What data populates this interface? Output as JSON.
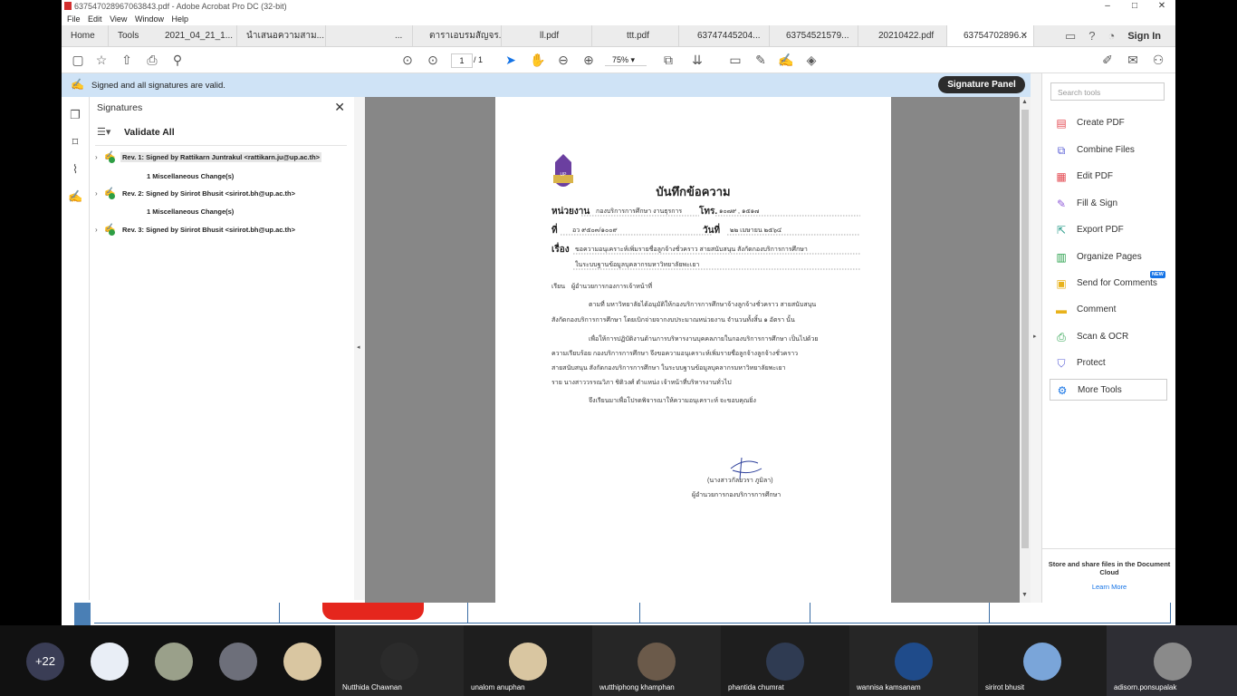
{
  "window": {
    "title": "637547028967063843.pdf - Adobe Acrobat Pro DC (32-bit)",
    "controls": [
      "–",
      "□",
      "✕"
    ]
  },
  "menu": [
    "File",
    "Edit",
    "View",
    "Window",
    "Help"
  ],
  "tabs": [
    {
      "label": "Home"
    },
    {
      "label": "Tools"
    },
    {
      "label": "2021_04_21_1..."
    },
    {
      "label": "นำเสนอความสาม..."
    },
    {
      "label": "..."
    },
    {
      "label": "ตาราเอบรมสัญจร..."
    },
    {
      "label": "ll.pdf"
    },
    {
      "label": "ttt.pdf"
    },
    {
      "label": "63747445204..."
    },
    {
      "label": "63754521579..."
    },
    {
      "label": "20210422.pdf"
    },
    {
      "label": "63754702896...",
      "active": true
    }
  ],
  "header_right": {
    "sign_in": "Sign In"
  },
  "toolbar": {
    "page_current": "1",
    "page_total": "/ 1",
    "zoom": "75%"
  },
  "signature_bar": {
    "message": "Signed and all signatures are valid.",
    "panel_button": "Signature Panel"
  },
  "signatures_panel": {
    "title": "Signatures",
    "validate_all": "Validate All",
    "revisions": [
      {
        "label": "Rev. 1: Signed by Rattikarn Juntrakul <rattikarn.ju@up.ac.th>",
        "sub": "1 Miscellaneous Change(s)"
      },
      {
        "label": "Rev. 2: Signed by Sirirot Bhusit <sirirot.bh@up.ac.th>",
        "sub": "1 Miscellaneous Change(s)"
      },
      {
        "label": "Rev. 3: Signed by Sirirot Bhusit <sirirot.bh@up.ac.th>",
        "sub": ""
      }
    ]
  },
  "document": {
    "logo_text": "UP",
    "title": "บันทึกข้อความ",
    "agency_label": "หน่วยงาน",
    "agency_value": "กองบริการการศึกษา  งานธุรการ",
    "phone_label": "โทร.",
    "phone_value": "๑๐๗๙ , ๑๕๑๗",
    "ref_label": "ที่",
    "ref_value": "อว ๙๕๐๓/๑๐๐๙",
    "date_label": "วันที่",
    "date_value": "๒๒ เมษายน ๒๕๖๔",
    "subject_label": "เรื่อง",
    "subject_line1": "ขอความอนุเคราะห์เพิ่มรายชื่อลูกจ้างชั่วคราว สายสนับสนุน สังกัดกองบริการการศึกษา",
    "subject_line2": "ในระบบฐานข้อมูลบุคลากรมหาวิทยาลัยพะเยา",
    "to_label": "เรียน",
    "to_value": "ผู้อำนวยการกองการเจ้าหน้าที่",
    "para1_l1": "ตามที่ มหาวิทยาลัยได้อนุมัติให้กองบริการการศึกษาจ้างลูกจ้างชั่วคราว สายสนับสนุน",
    "para1_l2": "สังกัดกองบริการการศึกษา โดยเบิกจ่ายจากงบประมาณหน่วยงาน จำนวนทั้งสิ้น ๑ อัตรา นั้น",
    "para2_l1": "เพื่อให้การปฏิบัติงานด้านการบริหารงานบุคคลภายในกองบริการการศึกษา เป็นไปด้วย",
    "para2_l2": "ความเรียบร้อย กองบริการการศึกษา จึงขอความอนุเคราะห์เพิ่มรายชื่อลูกจ้างลูกจ้างชั่วคราว",
    "para2_l3": "สายสนับสนุน สังกัดกองบริการการศึกษา ในระบบฐานข้อมูลบุคลากรมหาวิทยาลัยพะเยา",
    "para2_l4": "ราย นางสาววรรณวิภา  ชิติวงศ์ ตำแหน่ง เจ้าหน้าที่บริหารงานทั่วไป",
    "closing": "จึงเรียนมาเพื่อโปรดพิจารณาให้ความอนุเคราะห์ จะขอบคุณยิ่ง",
    "signer_name": "(นางสาวกัลยวรา  ภูมิลา)",
    "signer_position": "ผู้อำนวยการกองบริการการศึกษา"
  },
  "tools": {
    "search_placeholder": "Search tools",
    "items": [
      {
        "label": "Create PDF",
        "icon": "create-pdf-icon",
        "color": "#e34850"
      },
      {
        "label": "Combine Files",
        "icon": "combine-files-icon",
        "color": "#5a5fd6"
      },
      {
        "label": "Edit PDF",
        "icon": "edit-pdf-icon",
        "color": "#e34850"
      },
      {
        "label": "Fill & Sign",
        "icon": "fill-sign-icon",
        "color": "#8f5bd8"
      },
      {
        "label": "Export PDF",
        "icon": "export-pdf-icon",
        "color": "#2a9c8a"
      },
      {
        "label": "Organize Pages",
        "icon": "organize-pages-icon",
        "color": "#27a04a"
      },
      {
        "label": "Send for Comments",
        "icon": "send-comments-icon",
        "color": "#e8b21b"
      },
      {
        "label": "Comment",
        "icon": "comment-icon",
        "color": "#e8b21b"
      },
      {
        "label": "Scan & OCR",
        "icon": "scan-ocr-icon",
        "color": "#27a04a"
      },
      {
        "label": "Protect",
        "icon": "protect-icon",
        "color": "#5a5fd6"
      },
      {
        "label": "More Tools",
        "icon": "more-tools-icon",
        "color": "#1473e6"
      }
    ],
    "new_badge": "NEW",
    "store_text": "Store and share files in the Document Cloud",
    "learn_more": "Learn More"
  },
  "meeting": {
    "more_count": "+22",
    "participants": [
      {
        "name": "Nutthida Chawnan",
        "color": "#2b2b2b"
      },
      {
        "name": "unalom anuphan",
        "color": "#d9c6a1"
      },
      {
        "name": "wutthiphong khamphan",
        "color": "#6b5a4a"
      },
      {
        "name": "phantida chumrat",
        "color": "#2f3b52"
      },
      {
        "name": "wannisa kamsanam",
        "color": "#1f4b8a"
      },
      {
        "name": "sirirot bhusit",
        "color": "#7aa5d9"
      },
      {
        "name": "adisorn.ponsupalak",
        "color": "#8a8a8a"
      }
    ],
    "unnamed_colors": [
      "#e9eef6",
      "#9aa08a",
      "#6d6f7a",
      "#d9c6a1"
    ]
  }
}
